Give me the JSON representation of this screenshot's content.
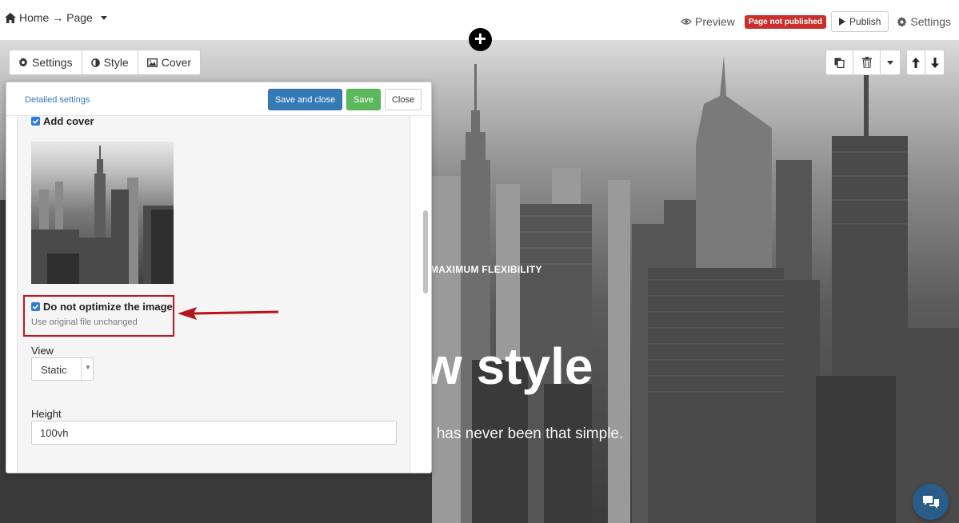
{
  "topbar": {
    "breadcrumb": "Home → Page",
    "preview_label": "Preview",
    "status_badge": "Page not published",
    "publish_label": "Publish",
    "settings_label": "Settings"
  },
  "block_tabs": [
    {
      "label": "Settings",
      "icon": "gear-icon"
    },
    {
      "label": "Style",
      "icon": "contrast-icon"
    },
    {
      "label": "Cover",
      "icon": "image-icon"
    }
  ],
  "panel": {
    "detailed_settings": "Detailed settings",
    "save_and_close": "Save and close",
    "save": "Save",
    "close": "Close",
    "add_cover_label": "Add cover",
    "dont_optimize_label": "Do not optimize the image",
    "dont_optimize_help": "Use original file unchanged",
    "view_label": "View",
    "view_value": "Static",
    "height_label": "Height",
    "height_value": "100vh"
  },
  "hero": {
    "eyebrow": "MAXIMUM FLEXIBILITY",
    "title": "w style",
    "subtitle": "e has never been that simple."
  },
  "colors": {
    "accent_blue": "#337ab7",
    "save_green": "#5cb85c",
    "badge_red": "#c9302c",
    "highlight_red": "#c1121f"
  }
}
